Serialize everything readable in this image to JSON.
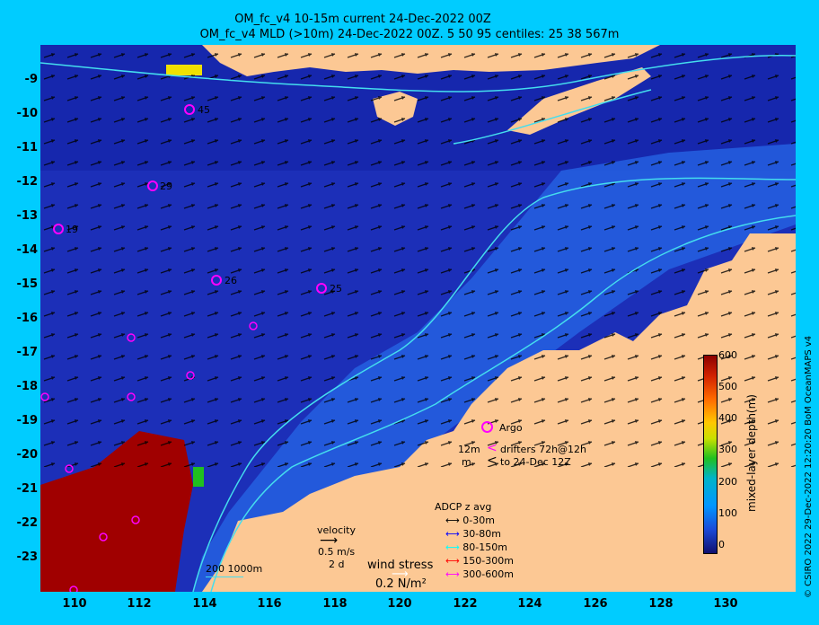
{
  "title_line1": "OM_fc_v4  10-15m current 24-Dec-2022 00Z",
  "title_line2": "OM_fc_v4  MLD (>10m) 24-Dec-2022 00Z. 5 50 95 centiles: 25   38  567m",
  "y_ticks": [
    "-9",
    "-10",
    "-11",
    "-12",
    "-13",
    "-14",
    "-15",
    "-16",
    "-17",
    "-18",
    "-19",
    "-20",
    "-21",
    "-22",
    "-23"
  ],
  "x_ticks": [
    "110",
    "112",
    "114",
    "116",
    "118",
    "120",
    "122",
    "124",
    "126",
    "128",
    "130"
  ],
  "colorbar": {
    "title": "mixed-layer depth(m)",
    "ticks": [
      "600",
      "500",
      "400",
      "300",
      "200",
      "100",
      "0"
    ]
  },
  "copyright": "© CSIRO 2022   29-Dec-2022 12:20:20 BoM OceanMAPS v4",
  "legend": {
    "argo": "Argo",
    "drifter_depth": "12m",
    "drifter_label": "drifters 72h@12h",
    "drifter_m": "m",
    "drifter_to": "to 24-Dec 12Z",
    "adcp_title": "ADCP z avg",
    "adcp_items": [
      {
        "label": "0-30m",
        "color": "#000000"
      },
      {
        "label": "30-80m",
        "color": "#0000ff"
      },
      {
        "label": "80-150m",
        "color": "#00ffff"
      },
      {
        "label": "150-300m",
        "color": "#ff0000"
      },
      {
        "label": "300-600m",
        "color": "#ff00ff"
      }
    ],
    "velocity_title": "velocity",
    "velocity_speed": "0.5 m/s",
    "velocity_time": "2 d",
    "wind_title": "wind stress",
    "wind_value": "0.2 N/m²",
    "isobaths": "200  1000m"
  },
  "argo_floats": [
    {
      "label": "45"
    },
    {
      "label": "29"
    },
    {
      "label": "19"
    },
    {
      "label": "26"
    },
    {
      "label": "25"
    }
  ],
  "colors": {
    "ocean_deep": "#1c2fb8",
    "land": "#fcc894",
    "isobath": "#44ddee",
    "mld_high": "#a00000",
    "background": "#00ccff"
  }
}
